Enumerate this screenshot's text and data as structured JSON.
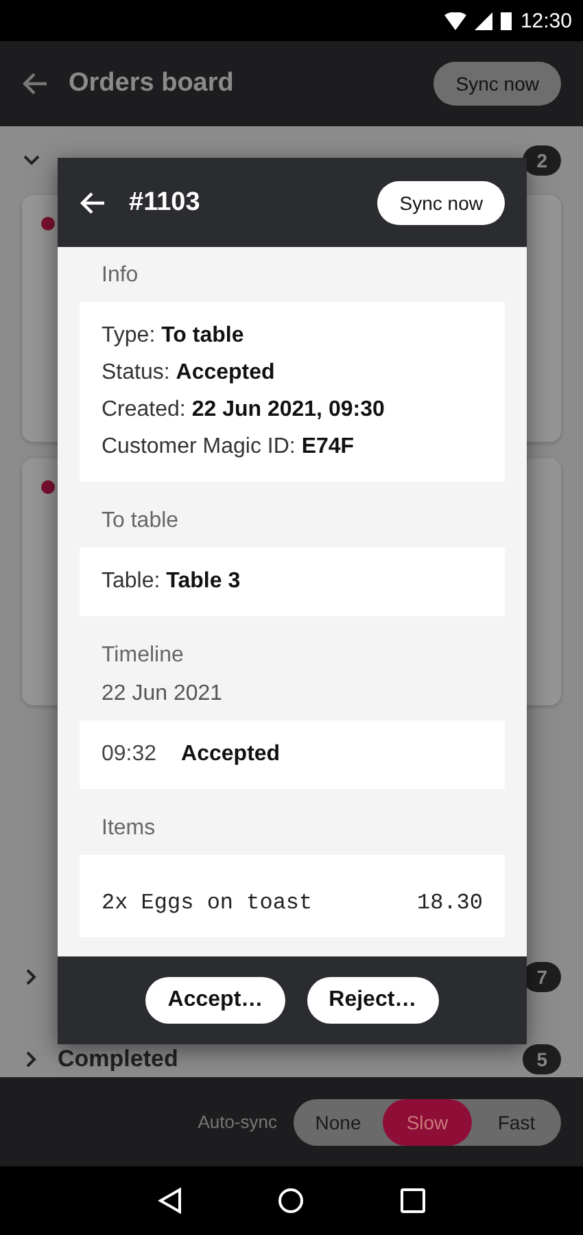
{
  "status_bar": {
    "time": "12:30"
  },
  "app_bar": {
    "title": "Orders board",
    "sync_button": "Sync now"
  },
  "sections": [
    {
      "expanded": true,
      "count": "2",
      "cards": [
        {
          "unread": true
        },
        {
          "unread": true
        }
      ]
    },
    {
      "expanded": false,
      "count": "7"
    },
    {
      "expanded": false,
      "label": "Completed",
      "count": "5"
    }
  ],
  "auto_sync": {
    "label": "Auto-sync",
    "options": [
      {
        "label": "None",
        "selected": false
      },
      {
        "label": "Slow",
        "selected": true
      },
      {
        "label": "Fast",
        "selected": false
      }
    ]
  },
  "dialog": {
    "title": "#1103",
    "sync_button": "Sync now",
    "sections": [
      {
        "heading": "Info",
        "kind": "fields",
        "fields": [
          {
            "label": "Type:",
            "value": "To table"
          },
          {
            "label": "Status:",
            "value": "Accepted"
          },
          {
            "label": "Created:",
            "value": "22 Jun 2021, 09:30"
          },
          {
            "label": "Customer Magic ID:",
            "value": "E74F"
          }
        ]
      },
      {
        "heading": "To table",
        "kind": "fields",
        "fields": [
          {
            "label": "Table:",
            "value": "Table 3"
          }
        ]
      },
      {
        "heading": "Timeline",
        "kind": "timeline",
        "date": "22 Jun 2021",
        "events": [
          {
            "time": "09:32",
            "status": "Accepted"
          }
        ]
      },
      {
        "heading": "Items",
        "kind": "items",
        "items": [
          {
            "name": "2x Eggs on toast",
            "price": "18.30"
          }
        ]
      }
    ],
    "actions": [
      "Accept…",
      "Reject…"
    ]
  }
}
